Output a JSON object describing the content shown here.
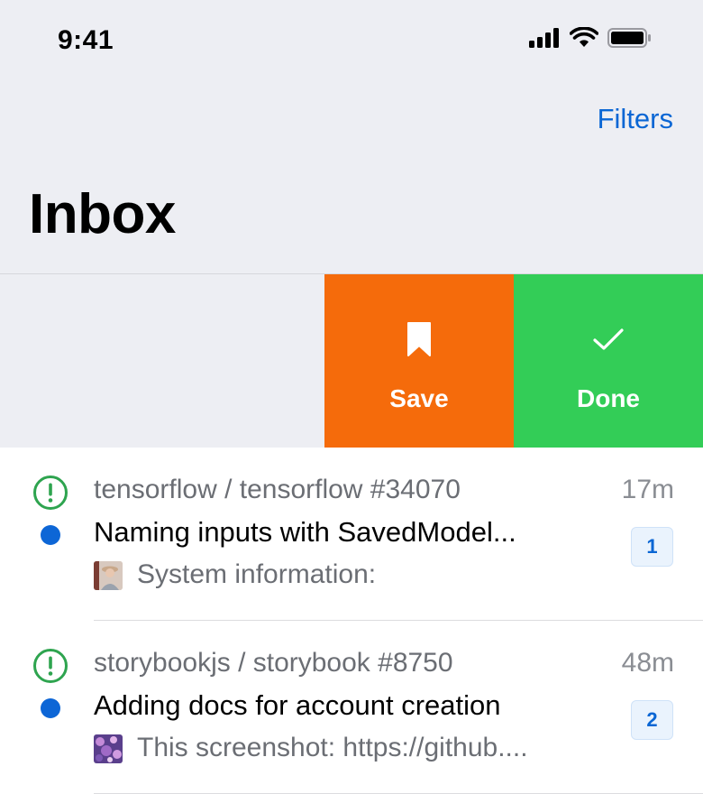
{
  "status_bar": {
    "time": "9:41"
  },
  "header": {
    "filters_label": "Filters",
    "title": "Inbox"
  },
  "swipe_actions": {
    "save_label": "Save",
    "done_label": "Done"
  },
  "colors": {
    "accent": "#0a66d4",
    "save": "#f56b0b",
    "done": "#33cd57",
    "issue_open": "#2ea44f"
  },
  "notifications": [
    {
      "repo": "tensorflow / tensorflow #34070",
      "time": "17m",
      "subject": "Naming inputs with SavedModel...",
      "count": "1",
      "snippet": "System information:"
    },
    {
      "repo": "storybookjs / storybook #8750",
      "time": "48m",
      "subject": "Adding docs for account creation",
      "count": "2",
      "snippet": "This screenshot: https://github...."
    }
  ]
}
